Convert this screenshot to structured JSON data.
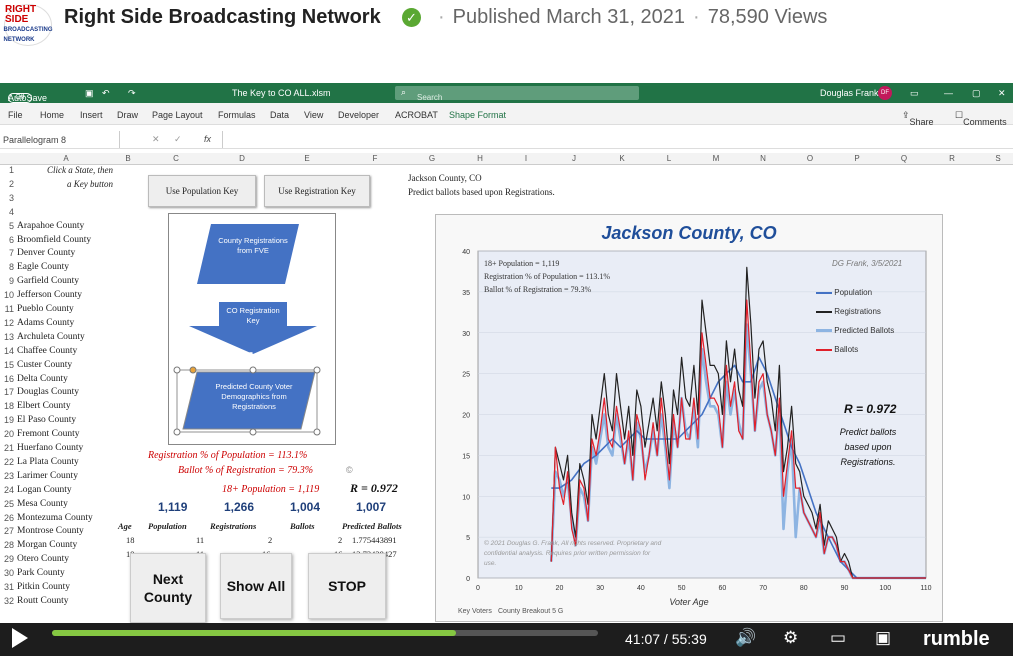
{
  "video_header": {
    "logo_line1": "RIGHT SIDE",
    "logo_line2": "BROADCASTING NETWORK",
    "channel": "Right Side Broadcasting Network",
    "published": "Published March 31, 2021",
    "views": "78,590 Views"
  },
  "excel": {
    "autosave_label": "AutoSave",
    "autosave_state": "Off",
    "file_title": "The Key to CO ALL.xlsm",
    "search_placeholder": "Search",
    "user_name": "Douglas Frank",
    "user_initials": "DF",
    "menu": [
      "File",
      "Home",
      "Insert",
      "Draw",
      "Page Layout",
      "Formulas",
      "Data",
      "View",
      "Developer",
      "ACROBAT",
      "Shape Format"
    ],
    "share_label": "Share",
    "comments_label": "Comments",
    "name_box": "Parallelogram 8",
    "columns": [
      "A",
      "B",
      "C",
      "D",
      "E",
      "F",
      "G",
      "H",
      "I",
      "J",
      "K",
      "L",
      "M",
      "N",
      "O",
      "P",
      "Q",
      "R",
      "S"
    ],
    "instruction_line1": "Click a State, then",
    "instruction_line2": "a Key button",
    "btn_population": "Use Population Key",
    "btn_registration": "Use Registration Key",
    "context_line1": "Jackson County, CO",
    "context_line2": "Predict ballots based upon Registrations.",
    "counties": [
      "Arapahoe County",
      "Broomfield County",
      "Denver County",
      "Eagle County",
      "Garfield County",
      "Jefferson County",
      "Pueblo County",
      "Adams County",
      "Archuleta County",
      "Chaffee County",
      "Custer County",
      "Delta County",
      "Douglas County",
      "Elbert County",
      "El Paso County",
      "Fremont County",
      "Huerfano County",
      "La Plata County",
      "Larimer County",
      "Logan County",
      "Mesa County",
      "Montezuma County",
      "Montrose County",
      "Morgan County",
      "Otero County",
      "Park County",
      "Pitkin County",
      "Routt County"
    ],
    "diagram": {
      "box1": "County Registrations from FVE",
      "arrow": "CO Registration Key",
      "box2": "Predicted County Voter Demographics from Registrations"
    },
    "stat_registration": "Registration % of Population = 113.1%",
    "stat_ballot": "Ballot % of Registration = 79.3%",
    "stat_pop": "18+ Population = 1,119",
    "stat_r": "R = 0.972",
    "totals": [
      "1,119",
      "1,266",
      "1,004",
      "1,007"
    ],
    "table_headers": [
      "Age",
      "Population",
      "Registrations",
      "Ballots",
      "Predicted Ballots"
    ],
    "table_rows": [
      [
        "18",
        "11",
        "2",
        "2",
        "1.775443891"
      ],
      [
        "19",
        "11",
        "16",
        "16",
        "13.73429427"
      ]
    ],
    "big_buttons": {
      "next": "Next County",
      "show_all": "Show All",
      "stop": "STOP"
    },
    "sheet_tabs": [
      "Key Voters",
      "County Breakout 5 G"
    ]
  },
  "chart_data": {
    "type": "line",
    "title": "Jackson County, CO",
    "xlabel": "Voter Age",
    "ylabel": "",
    "xlim": [
      0,
      110
    ],
    "ylim": [
      0,
      40
    ],
    "xticks": [
      0,
      10,
      20,
      30,
      40,
      50,
      60,
      70,
      80,
      90,
      100,
      110
    ],
    "yticks": [
      0,
      5,
      10,
      15,
      20,
      25,
      30,
      35,
      40
    ],
    "info_lines": [
      "18+ Population = 1,119",
      "Registration % of Population = 113.1%",
      "Ballot % of Registration = 79.3%"
    ],
    "author_note": "DG Frank, 3/5/2021",
    "r_value": "R = 0.972",
    "predict_note": "Predict ballots based upon Registrations.",
    "copyright": "© 2021 Douglas G. Frank, All rights reserved. Proprietary and confidential analysis. Requires prior written permission for use.",
    "legend_position": "right",
    "series": [
      {
        "name": "Population",
        "color": "#4472c4",
        "x": [
          18,
          20,
          23,
          26,
          29,
          31,
          33,
          35,
          37,
          39,
          41,
          43,
          45,
          47,
          49,
          51,
          53,
          55,
          57,
          59,
          61,
          63,
          65,
          67,
          69,
          71,
          73,
          75,
          77,
          79,
          81,
          83,
          85,
          87,
          89,
          91,
          93,
          100,
          110
        ],
        "y": [
          11,
          11,
          12,
          14,
          15,
          16,
          17,
          16,
          17,
          18,
          17,
          17,
          17,
          17,
          17,
          18,
          19,
          20,
          22,
          24,
          25,
          26,
          24,
          24,
          27,
          25,
          22,
          19,
          16,
          14,
          11,
          8,
          6,
          4,
          2,
          1,
          0,
          0,
          0
        ]
      },
      {
        "name": "Registrations",
        "color": "#222222",
        "x": [
          18,
          19,
          20,
          21,
          22,
          23,
          24,
          25,
          26,
          27,
          28,
          29,
          30,
          31,
          32,
          33,
          34,
          35,
          36,
          37,
          38,
          39,
          40,
          41,
          42,
          43,
          44,
          45,
          46,
          47,
          48,
          49,
          50,
          51,
          52,
          53,
          54,
          55,
          56,
          57,
          58,
          59,
          60,
          61,
          62,
          63,
          64,
          65,
          66,
          67,
          68,
          69,
          70,
          71,
          72,
          73,
          74,
          75,
          76,
          77,
          78,
          79,
          80,
          81,
          82,
          83,
          84,
          85,
          86,
          87,
          88,
          89,
          90,
          91,
          92,
          93,
          95,
          100,
          110
        ],
        "y": [
          2,
          16,
          14,
          12,
          15,
          8,
          5,
          14,
          12,
          9,
          20,
          17,
          21,
          25,
          20,
          18,
          25,
          21,
          17,
          21,
          15,
          23,
          21,
          16,
          19,
          22,
          18,
          24,
          20,
          14,
          23,
          20,
          27,
          22,
          21,
          26,
          20,
          34,
          30,
          26,
          26,
          25,
          20,
          29,
          24,
          28,
          23,
          21,
          38,
          31,
          22,
          28,
          29,
          24,
          22,
          18,
          26,
          13,
          16,
          21,
          14,
          13,
          10,
          9,
          8,
          6,
          9,
          4,
          7,
          6,
          5,
          2,
          3,
          2,
          0,
          0,
          0,
          0,
          0
        ]
      },
      {
        "name": "Predicted Ballots",
        "color": "#8db4e2",
        "x": [
          18,
          19,
          20,
          21,
          22,
          23,
          24,
          25,
          26,
          27,
          28,
          29,
          30,
          31,
          32,
          33,
          34,
          35,
          36,
          37,
          38,
          39,
          40,
          41,
          42,
          43,
          44,
          45,
          46,
          47,
          48,
          49,
          50,
          51,
          52,
          53,
          54,
          55,
          56,
          57,
          58,
          59,
          60,
          61,
          62,
          63,
          64,
          65,
          66,
          67,
          68,
          69,
          70,
          71,
          72,
          73,
          74,
          75,
          76,
          77,
          78,
          79,
          80,
          81,
          82,
          83,
          84,
          85,
          86,
          87,
          88,
          89,
          90,
          91,
          92,
          93,
          95,
          100,
          110
        ],
        "y": [
          2,
          13,
          12,
          10,
          12,
          7,
          4,
          11,
          10,
          7,
          16,
          14,
          17,
          20,
          16,
          15,
          20,
          17,
          14,
          17,
          12,
          19,
          17,
          13,
          15,
          18,
          15,
          20,
          16,
          11,
          19,
          16,
          22,
          18,
          17,
          21,
          16,
          28,
          24,
          21,
          21,
          20,
          16,
          24,
          20,
          23,
          19,
          17,
          31,
          25,
          18,
          23,
          24,
          20,
          18,
          15,
          21,
          6,
          13,
          17,
          5,
          11,
          8,
          7,
          6,
          5,
          7,
          3,
          5,
          5,
          4,
          2,
          2,
          1,
          0,
          0,
          0,
          0,
          0
        ]
      },
      {
        "name": "Ballots",
        "color": "#e0202a",
        "x": [
          18,
          19,
          20,
          21,
          22,
          23,
          24,
          25,
          26,
          27,
          28,
          29,
          30,
          31,
          32,
          33,
          34,
          35,
          36,
          37,
          38,
          39,
          40,
          41,
          42,
          43,
          44,
          45,
          46,
          47,
          48,
          49,
          50,
          51,
          52,
          53,
          54,
          55,
          56,
          57,
          58,
          59,
          60,
          61,
          62,
          63,
          64,
          65,
          66,
          67,
          68,
          69,
          70,
          71,
          72,
          73,
          74,
          75,
          76,
          77,
          78,
          79,
          80,
          81,
          82,
          83,
          84,
          85,
          86,
          87,
          88,
          89,
          90,
          91,
          92,
          93,
          95,
          100,
          110
        ],
        "y": [
          2,
          16,
          11,
          9,
          13,
          6,
          4,
          12,
          11,
          7,
          17,
          15,
          18,
          22,
          17,
          16,
          21,
          18,
          14,
          18,
          12,
          20,
          18,
          12,
          15,
          19,
          15,
          22,
          17,
          12,
          20,
          16,
          22,
          17,
          17,
          22,
          17,
          30,
          26,
          22,
          22,
          21,
          16,
          26,
          21,
          24,
          18,
          17,
          34,
          26,
          18,
          24,
          25,
          20,
          18,
          15,
          22,
          10,
          14,
          18,
          11,
          11,
          8,
          7,
          6,
          5,
          8,
          3,
          5,
          5,
          4,
          2,
          2,
          1,
          0,
          0,
          0,
          0,
          0
        ]
      }
    ]
  },
  "player": {
    "time": "41:07 / 55:39",
    "progress_fraction": 0.74,
    "brand": "rumble"
  }
}
